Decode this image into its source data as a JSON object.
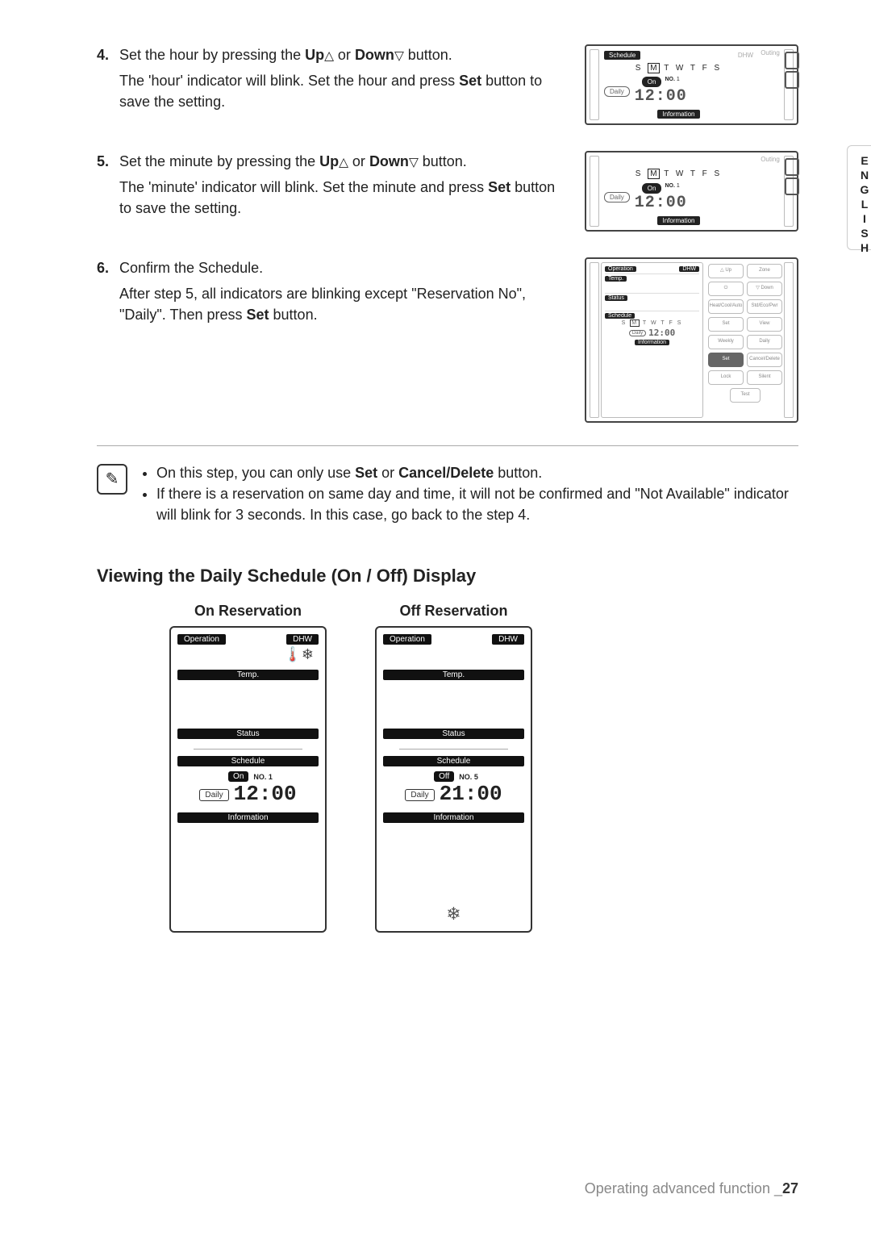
{
  "language_tab": "ENGLISH",
  "steps": {
    "s4": {
      "num": "4.",
      "text_a": "Set the hour by pressing the ",
      "up": "Up",
      "or": " or ",
      "down": "Down",
      "text_b": " button.",
      "sub_a": "The 'hour' indicator will blink. Set the hour and press ",
      "set": "Set",
      "sub_b": " button to save the setting."
    },
    "s5": {
      "num": "5.",
      "text_a": "Set the minute by pressing the ",
      "up": "Up",
      "or": " or ",
      "down": "Down",
      "text_b": " button.",
      "sub_a": "The 'minute' indicator will blink. Set the minute and press ",
      "set": "Set",
      "sub_b": " button to save the setting."
    },
    "s6": {
      "num": "6.",
      "text_a": "Confirm the Schedule.",
      "sub_a": "After step 5, all indicators are blinking except \"Reservation No\", \"Daily\". Then press ",
      "set": "Set",
      "sub_b": " button."
    }
  },
  "mini_lcd": {
    "schedule": "Schedule",
    "dhw": "DHW",
    "days": "S M T W F S",
    "on": "On",
    "no": "NO.",
    "no_val": "1",
    "daily": "Daily",
    "time": "12:00",
    "info": "Information",
    "outing": "Outing"
  },
  "med_lcd": {
    "operation": "Operation",
    "dhw": "DHW",
    "temp": "Temp.",
    "status": "Status",
    "schedule": "Schedule",
    "days": "S M T W F S",
    "daily": "Daily",
    "time": "12:00",
    "info": "Information",
    "btn_up": "△ Up",
    "btn_down": "▽ Down",
    "btn_zone": "Zone",
    "btn_pwr": "⏻",
    "btn_mode": "Heat/Cool/Auto",
    "btn_eco": "Std/Eco/Pwr",
    "btn_set": "Set",
    "btn_view": "View",
    "btn_weekly": "Weekly",
    "btn_daily": "Daily",
    "btn_set2": "Set",
    "btn_cancel": "Cancel/Delete",
    "btn_lock": "Lock",
    "btn_silent": "Silent",
    "btn_test": "Test"
  },
  "note": {
    "b1_a": "On this step, you can only use ",
    "b1_set": "Set",
    "b1_or": " or ",
    "b1_cancel": "Cancel/Delete",
    "b1_b": " button.",
    "b2": "If there is a reservation on same day and time, it will not be confirmed and \"Not Available\" indicator will blink for 3 seconds. In this case, go back to the step 4."
  },
  "section_title": "Viewing the  Daily Schedule (On / Off) Display",
  "viewing": {
    "on_title": "On Reservation",
    "off_title": "Off Reservation",
    "operation": "Operation",
    "dhw": "DHW",
    "temp": "Temp.",
    "status": "Status",
    "schedule": "Schedule",
    "info": "Information",
    "on": "On",
    "off": "Off",
    "no": "NO.",
    "daily": "Daily",
    "on_no_val": "1",
    "off_no_val": "5",
    "on_time": "12:00",
    "off_time": "21:00"
  },
  "footer": {
    "text": "Operating advanced function _",
    "page": "27"
  }
}
